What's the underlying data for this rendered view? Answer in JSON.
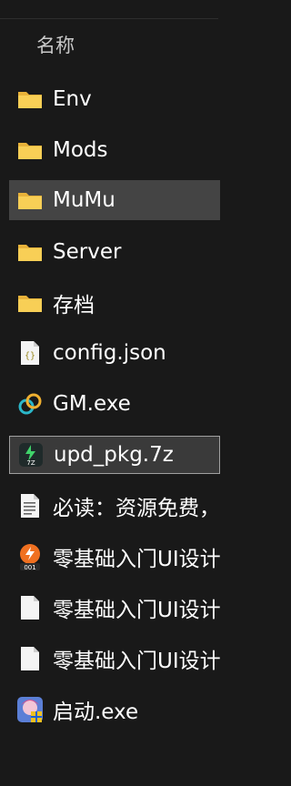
{
  "header": {
    "column_name": "名称"
  },
  "files": [
    {
      "name": "Env",
      "icon": "folder-icon"
    },
    {
      "name": "Mods",
      "icon": "folder-icon"
    },
    {
      "name": "MuMu",
      "icon": "folder-icon"
    },
    {
      "name": "Server",
      "icon": "folder-icon"
    },
    {
      "name": "存档",
      "icon": "folder-icon"
    },
    {
      "name": "config.json",
      "icon": "json-file-icon"
    },
    {
      "name": "GM.exe",
      "icon": "link-app-icon"
    },
    {
      "name": "upd_pkg.7z",
      "icon": "7z-archive-icon"
    },
    {
      "name": "必读：资源免费，",
      "icon": "text-file-icon"
    },
    {
      "name": "零基础入门UI设计",
      "icon": "video-file-icon"
    },
    {
      "name": "零基础入门UI设计",
      "icon": "blank-file-icon"
    },
    {
      "name": "零基础入门UI设计",
      "icon": "blank-file-icon"
    },
    {
      "name": "启动.exe",
      "icon": "anime-app-icon"
    }
  ],
  "colors": {
    "folder": "#f5c542",
    "hover_bg": "#444444",
    "selected_border": "#a0a0a0"
  }
}
